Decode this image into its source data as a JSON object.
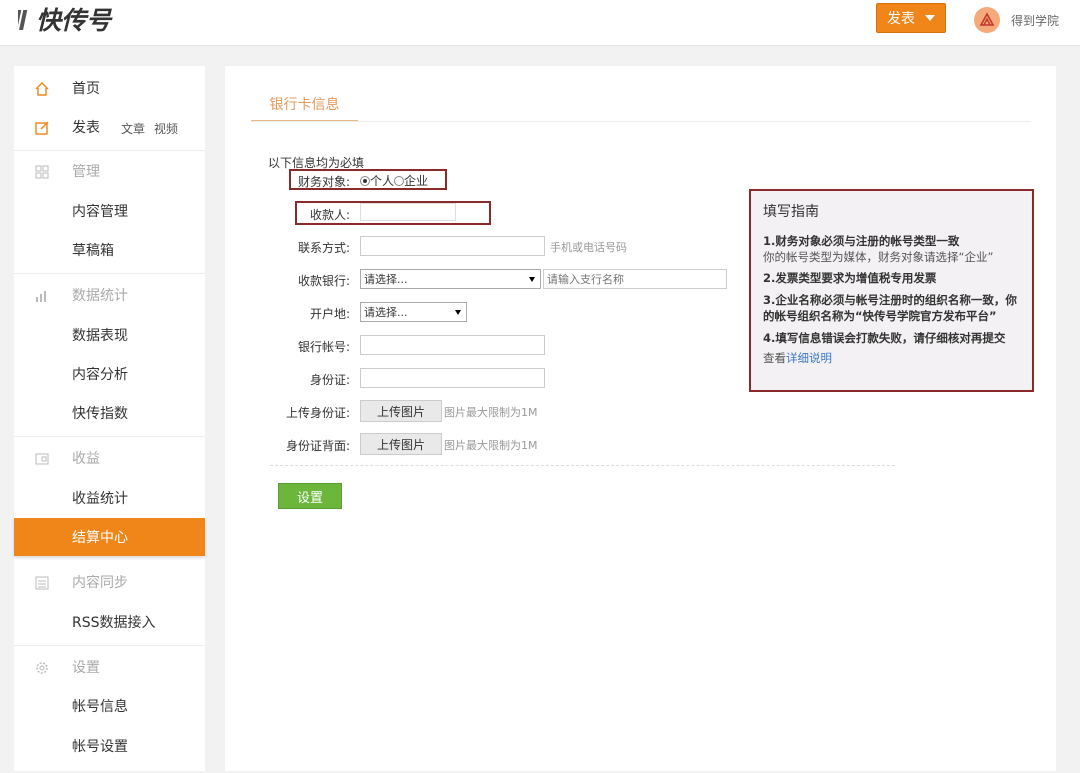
{
  "header": {
    "logo_text": "快传号",
    "publish_label": "发表",
    "username": "得到学院"
  },
  "sidebar": {
    "home": "首页",
    "publish": "发表",
    "publish_links": [
      "文章",
      "视频"
    ],
    "manage": "管理",
    "content_manage": "内容管理",
    "drafts": "草稿箱",
    "stats": "数据统计",
    "data_performance": "数据表现",
    "content_analysis": "内容分析",
    "kuaichuan_index": "快传指数",
    "income": "收益",
    "income_stats": "收益统计",
    "settlement": "结算中心",
    "content_sync": "内容同步",
    "rss": "RSS数据接入",
    "settings": "设置",
    "account_info": "帐号信息",
    "account_settings": "帐号设置"
  },
  "form": {
    "tab": "银行卡信息",
    "required_note": "以下信息均为必填",
    "finance_label": "财务对象:",
    "finance_options": [
      "个人",
      "企业"
    ],
    "payee_label": "收款人:",
    "contact_label": "联系方式:",
    "contact_hint": "手机或电话号码",
    "bank_label": "收款银行:",
    "bank_select": "请选择...",
    "branch_placeholder": "请输入支行名称",
    "region_label": "开户地:",
    "region_select": "请选择...",
    "account_label": "银行帐号:",
    "id_label": "身份证:",
    "upload_id_label": "上传身份证:",
    "upload_id_back_label": "身份证背面:",
    "upload_btn": "上传图片",
    "upload_hint": "图片最大限制为1M",
    "submit": "设置"
  },
  "guide": {
    "title": "填写指南",
    "item1": "1.财务对象必须与注册的帐号类型一致",
    "item1_note": "你的帐号类型为媒体，财务对象请选择“企业”",
    "item2": "2.发票类型要求为增值税专用发票",
    "item3": "3.企业名称必须与帐号注册时的组织名称一致，你的帐号组织名称为“快传号学院官方发布平台”",
    "item4": "4.填写信息错误会打款失败，请仔细核对再提交",
    "view": "查看",
    "detail_link": "详细说明"
  },
  "colors": {
    "accent": "#f08519",
    "submit": "#6bb63b",
    "highlight": "#8b2a2a"
  }
}
